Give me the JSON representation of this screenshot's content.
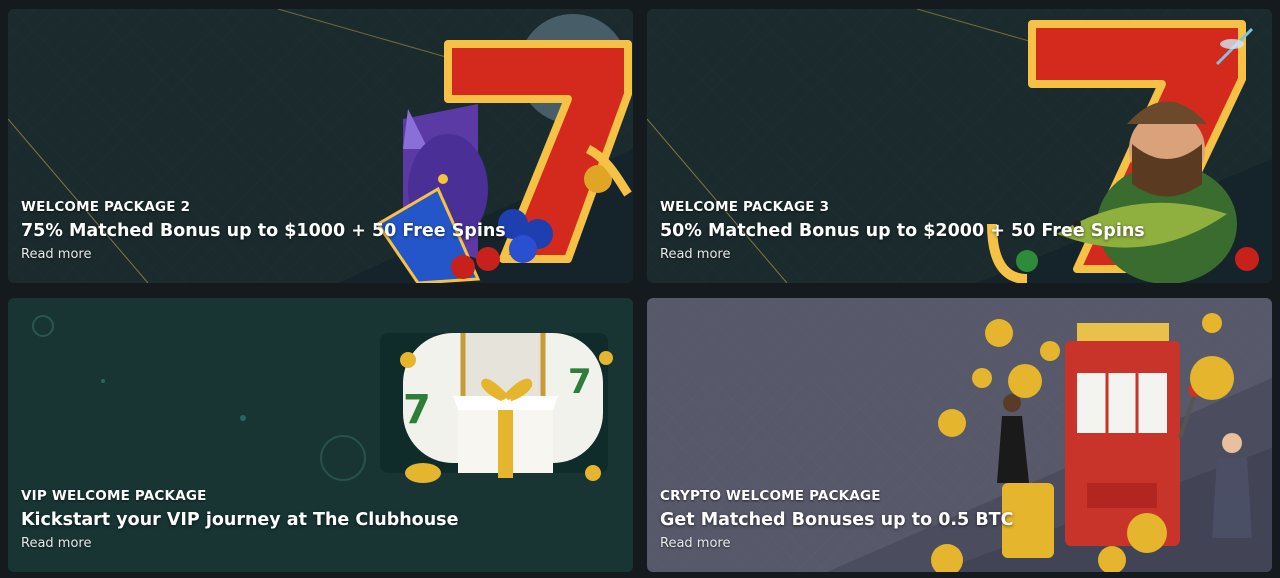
{
  "promotions": [
    {
      "kicker": "WELCOME PACKAGE 2",
      "headline": "75% Matched Bonus up to $1000 + 50 Free Spins",
      "link": "Read more",
      "theme_color": "#1b2b2d",
      "art": "wolf-lucky-seven-slot-icon"
    },
    {
      "kicker": "WELCOME PACKAGE 3",
      "headline": "50% Matched Bonus up to $2000 + 50 Free Spins",
      "link": "Read more",
      "theme_color": "#1b2b2d",
      "art": "fisherman-lucky-seven-slot-icon"
    },
    {
      "kicker": "VIP WELCOME PACKAGE",
      "headline": "Kickstart your VIP journey at The Clubhouse",
      "link": "Read more",
      "theme_color": "#183534",
      "art": "slot-reel-gift-box-icon"
    },
    {
      "kicker": "CRYPTO WELCOME PACKAGE",
      "headline": "Get Matched Bonuses up to 0.5 BTC",
      "link": "Read more",
      "theme_color": "#57596a",
      "art": "crypto-slot-machine-coins-icon"
    }
  ]
}
